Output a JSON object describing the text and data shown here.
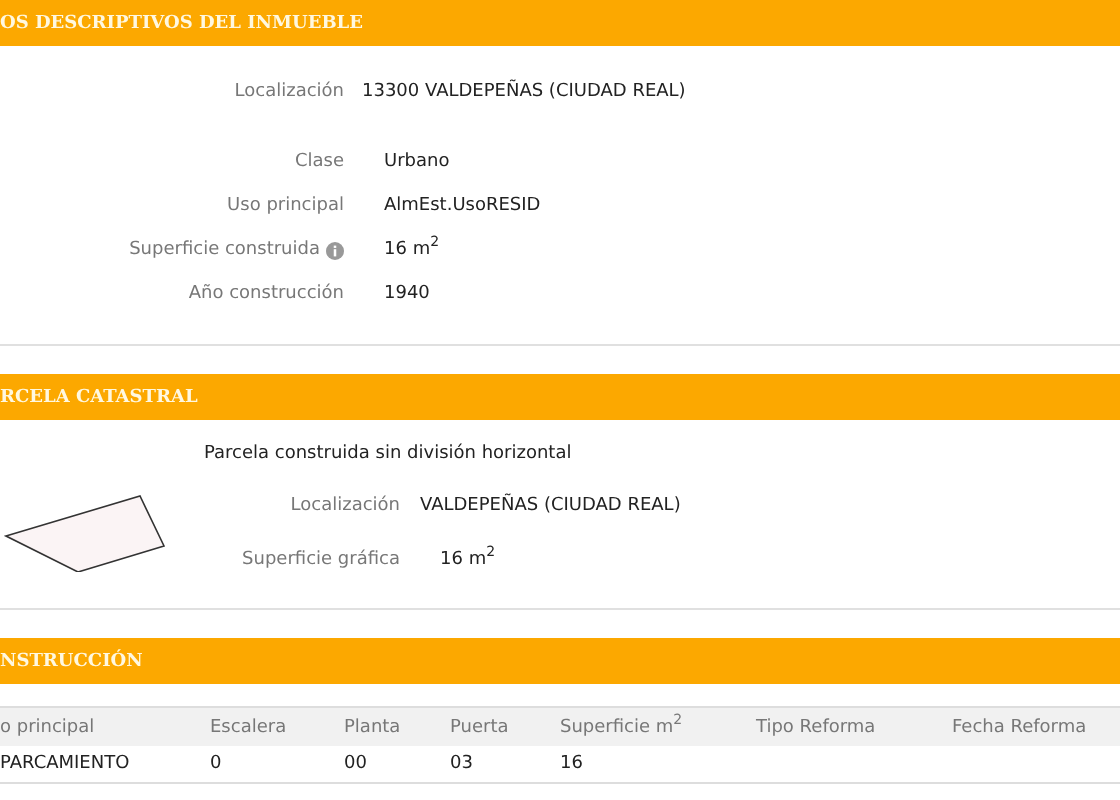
{
  "inmueble": {
    "title": "OS DESCRIPTIVOS DEL INMUEBLE",
    "fields": [
      {
        "label": "Localización",
        "value": "13300 VALDEPEÑAS (CIUDAD REAL)",
        "info": false
      },
      {
        "label": "Clase",
        "value": "Urbano",
        "info": false
      },
      {
        "label": "Uso principal",
        "value": "AlmEst.UsoRESID",
        "info": false
      },
      {
        "label": "Superficie construida",
        "value": "16 m$^{2}$",
        "info": true
      },
      {
        "label": "Año construcción",
        "value": "1940",
        "info": false
      }
    ]
  },
  "parcela": {
    "title": "RCELA CATASTRAL",
    "description": "Parcela construida sin división horizontal",
    "fields": [
      {
        "label": "Localización",
        "value": "VALDEPEÑAS (CIUDAD REAL)"
      },
      {
        "label": "Superficie gráfica",
        "value": "16 m$^{2}$"
      }
    ]
  },
  "construccion": {
    "title": "NSTRUCCIÓN",
    "columns": [
      "o principal",
      "Escalera",
      "Planta",
      "Puerta",
      "Superficie m$^{2}$",
      "Tipo Reforma",
      "Fecha Reforma"
    ],
    "rows": [
      [
        "PARCAMIENTO",
        "0",
        "00",
        "03",
        "16",
        "",
        ""
      ]
    ]
  }
}
